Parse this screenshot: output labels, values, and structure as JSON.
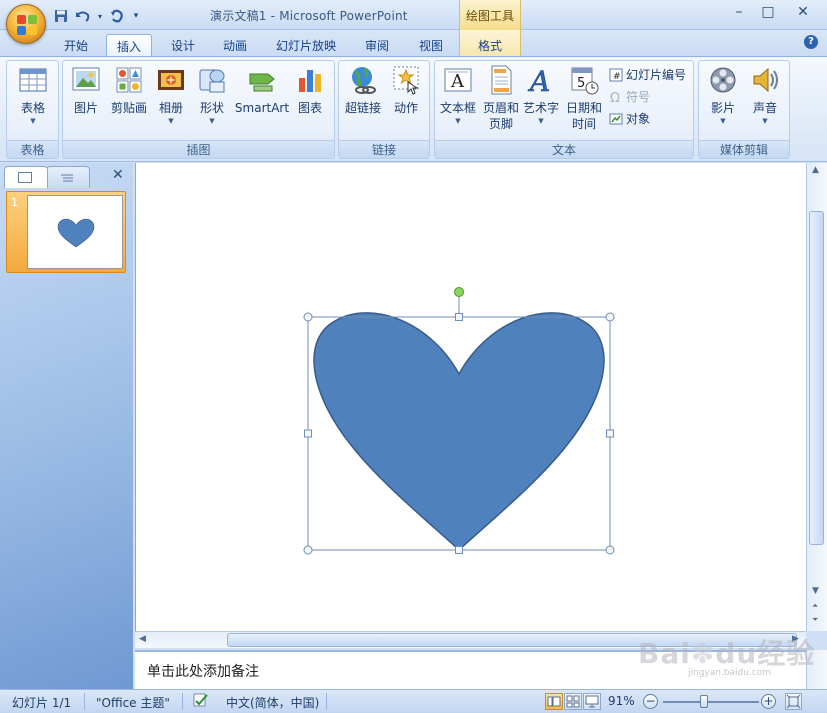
{
  "window": {
    "title": "演示文稿1 - Microsoft PowerPoint",
    "context_tools": "绘图工具",
    "controls": [
      "–",
      "□",
      "✕"
    ]
  },
  "tabs": [
    "开始",
    "插入",
    "设计",
    "动画",
    "幻灯片放映",
    "审阅",
    "视图",
    "格式"
  ],
  "active_tab": "插入",
  "ribbon": {
    "groups": {
      "table": {
        "label": "表格",
        "buttons": [
          "表格"
        ]
      },
      "illustrations": {
        "label": "插图",
        "buttons": [
          "图片",
          "剪贴画",
          "相册",
          "形状",
          "SmartArt",
          "图表"
        ]
      },
      "links": {
        "label": "链接",
        "buttons": [
          "超链接",
          "动作"
        ]
      },
      "text": {
        "label": "文本",
        "buttons": [
          "文本框",
          "页眉和",
          "页脚",
          "艺术字",
          "日期和",
          "时间"
        ],
        "small_buttons": [
          "幻灯片编号",
          "符号",
          "对象"
        ]
      },
      "media": {
        "label": "媒体剪辑",
        "buttons": [
          "影片",
          "声音"
        ]
      }
    }
  },
  "slides_panel": {
    "slide_number": "1"
  },
  "slide": {
    "shape": "heart",
    "shape_color": "#4f81bd",
    "shape_outline": "#385d8a"
  },
  "notes": {
    "placeholder": "单击此处添加备注"
  },
  "status": {
    "slide": "幻灯片 1/1",
    "theme": "\"Office 主题\"",
    "language": "中文(简体，中国)",
    "zoom": "91%"
  },
  "watermark": {
    "text": "Baidu经验",
    "sub": "jingyan.baidu.com"
  }
}
